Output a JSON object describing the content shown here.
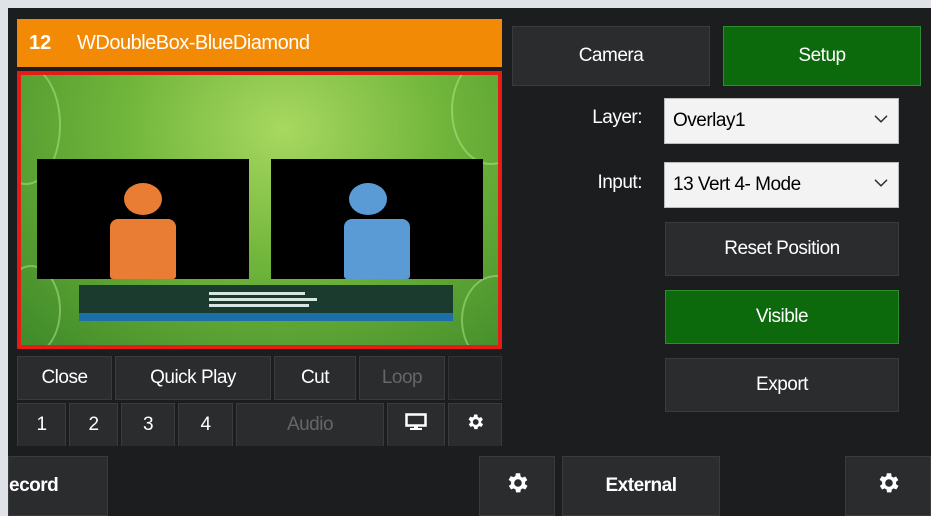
{
  "input": {
    "number": "12",
    "name": "WDoubleBox-BlueDiamond"
  },
  "tabs": {
    "camera": "Camera",
    "setup": "Setup"
  },
  "layer": {
    "label": "Layer:",
    "value": "Overlay1"
  },
  "input_select": {
    "label": "Input:",
    "value": "13 Vert 4- Mode"
  },
  "actions": {
    "reset_position": "Reset Position",
    "visible": "Visible",
    "export": "Export"
  },
  "controls": {
    "close": "Close",
    "quick_play": "Quick Play",
    "cut": "Cut",
    "loop": "Loop",
    "n1": "1",
    "n2": "2",
    "n3": "3",
    "n4": "4",
    "audio": "Audio"
  },
  "bottom": {
    "record": "ecord",
    "external": "External"
  },
  "icons": {
    "monitor": "monitor-icon",
    "gear": "gear-icon",
    "chevron": "chevron-down-icon"
  },
  "colors": {
    "title_bar": "#f28a05",
    "active_green": "#0c6a0c",
    "preview_border": "#e41b17",
    "orange_figure": "#ea7d34",
    "blue_figure": "#5b9bd5"
  }
}
